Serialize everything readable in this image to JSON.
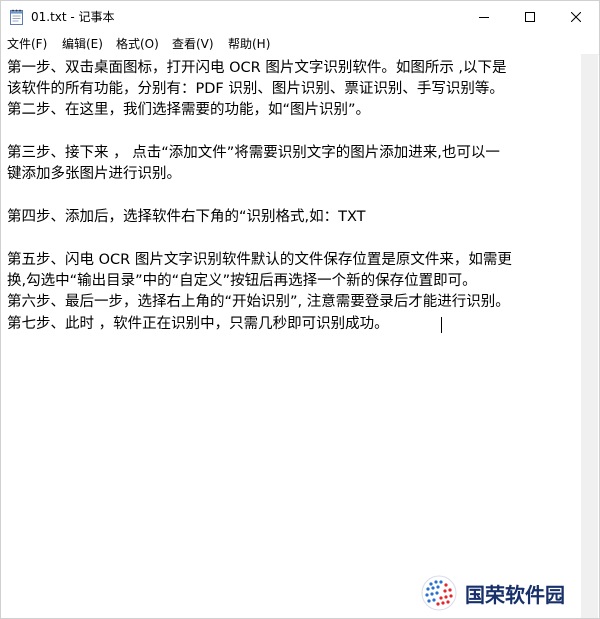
{
  "window": {
    "title": "01.txt - 记事本",
    "icon": "notepad-icon"
  },
  "controls": {
    "minimize_icon": "minimize-icon",
    "maximize_icon": "maximize-icon",
    "close_icon": "close-icon"
  },
  "menu": {
    "items": [
      {
        "label": "文件(F)"
      },
      {
        "label": "编辑(E)"
      },
      {
        "label": "格式(O)"
      },
      {
        "label": "查看(V)"
      },
      {
        "label": "帮助(H)"
      }
    ]
  },
  "editor": {
    "lines": [
      "第一步、双击桌面图标，打开闪电 OCR 图片文字识别软件。如图所示 ,以下是",
      "该软件的所有功能，分别有：PDF 识别、图片识别、票证识别、手写识别等。",
      "第二步、在这里，我们选择需要的功能，如“图片识别”。",
      "",
      "第三步、接下来 ， 点击“添加文件”将需要识别文字的图片添加进来,也可以一",
      "键添加多张图片进行识别。",
      "",
      "第四步、添加后，选择软件右下角的“识别格式,如：TXT",
      "",
      "第五步、闪电 OCR 图片文字识别软件默认的文件保存位置是原文件来，如需更",
      "换,勾选中“输出目录”中的“自定义”按钮后再选择一个新的保存位置即可。",
      "第六步、最后一步，选择右上角的“开始识别”, 注意需要登录后才能进行识别。",
      "第七步、此时 ，软件正在识别中，只需几秒即可识别成功。"
    ]
  },
  "watermark": {
    "text": "国荣软件园",
    "logo": "globe-logo-icon",
    "color": "#17306a"
  }
}
